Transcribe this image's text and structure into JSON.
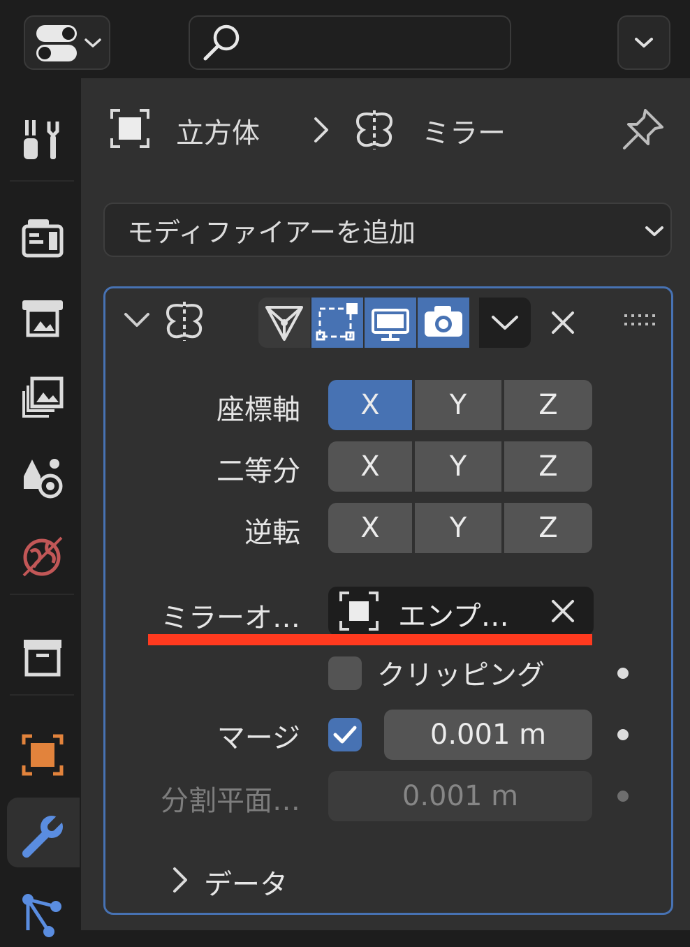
{
  "colors": {
    "accent": "#4772b3",
    "highlight_underline": "#ff3a1f",
    "object_icon": "#e2833c",
    "world_icon": "#c25757",
    "modifier_tab_icon": "#5a8de0"
  },
  "header": {
    "editor_type_icon": "properties-editor-icon",
    "search_icon": "search-icon",
    "search_value": "",
    "options_icon": "chevron-down-icon"
  },
  "tabs": [
    {
      "icon": "tool-icon",
      "active": false
    },
    {
      "icon": "render-icon",
      "active": false
    },
    {
      "icon": "output-icon",
      "active": false
    },
    {
      "icon": "view-layer-icon",
      "active": false
    },
    {
      "icon": "scene-icon",
      "active": false
    },
    {
      "icon": "world-icon",
      "active": false
    },
    {
      "icon": "collection-icon",
      "active": false
    },
    {
      "icon": "object-icon",
      "active": false
    },
    {
      "icon": "modifier-wrench-icon",
      "active": true
    },
    {
      "icon": "particles-icon",
      "active": false
    }
  ],
  "breadcrumb": {
    "object_name": "立方体",
    "separator": ">",
    "modifier_name": "ミラー"
  },
  "add_modifier": {
    "label": "モディファイアーを追加"
  },
  "modifier_panel": {
    "toggles": [
      {
        "name": "edit-cage",
        "active": false
      },
      {
        "name": "edit-mode",
        "active": true
      },
      {
        "name": "viewport",
        "active": true
      },
      {
        "name": "render",
        "active": true
      }
    ],
    "axis": {
      "label": "座標軸",
      "buttons": [
        "X",
        "Y",
        "Z"
      ],
      "active": [
        true,
        false,
        false
      ]
    },
    "bisect": {
      "label": "二等分",
      "buttons": [
        "X",
        "Y",
        "Z"
      ],
      "active": [
        false,
        false,
        false
      ]
    },
    "flip": {
      "label": "逆転",
      "buttons": [
        "X",
        "Y",
        "Z"
      ],
      "active": [
        false,
        false,
        false
      ]
    },
    "mirror_object": {
      "label": "ミラーオ…",
      "value": "エンプ…"
    },
    "clipping": {
      "label": "クリッピング",
      "checked": false
    },
    "merge": {
      "label": "マージ",
      "checked": true,
      "value": "0.001 m"
    },
    "bisect_distance": {
      "label": "分割平面…",
      "value": "0.001 m"
    },
    "data_section": {
      "label": "データ"
    }
  }
}
